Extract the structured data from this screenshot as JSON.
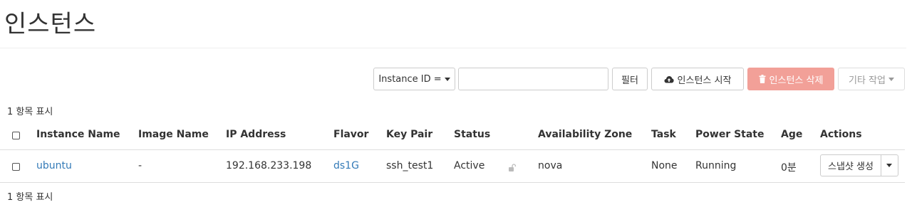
{
  "page": {
    "title": "인스턴스"
  },
  "toolbar": {
    "filter_select_label": "Instance ID =",
    "filter_input_value": "",
    "filter_button_label": "필터",
    "launch_button_label": "인스턴스 시작",
    "delete_button_label": "인스턴스 삭제",
    "more_actions_label": "기타 작업"
  },
  "table": {
    "count_label": "1 항목 표시",
    "columns": {
      "name": "Instance Name",
      "image": "Image Name",
      "ip": "IP Address",
      "flavor": "Flavor",
      "keypair": "Key Pair",
      "status": "Status",
      "az": "Availability Zone",
      "task": "Task",
      "power": "Power State",
      "age": "Age",
      "actions": "Actions"
    },
    "rows": [
      {
        "name": "ubuntu",
        "image": "-",
        "ip": "192.168.233.198",
        "flavor": "ds1G",
        "keypair": "ssh_test1",
        "status": "Active",
        "az": "nova",
        "task": "None",
        "power": "Running",
        "age": "0분",
        "action_label": "스냅샷 생성"
      }
    ]
  },
  "colors": {
    "link": "#337ab7",
    "danger_disabled": "#f2a098",
    "border": "#cccccc"
  },
  "icons": [
    "cloud-upload-icon",
    "trash-icon",
    "caret-down-icon",
    "unlock-icon",
    "checkbox-icon"
  ]
}
